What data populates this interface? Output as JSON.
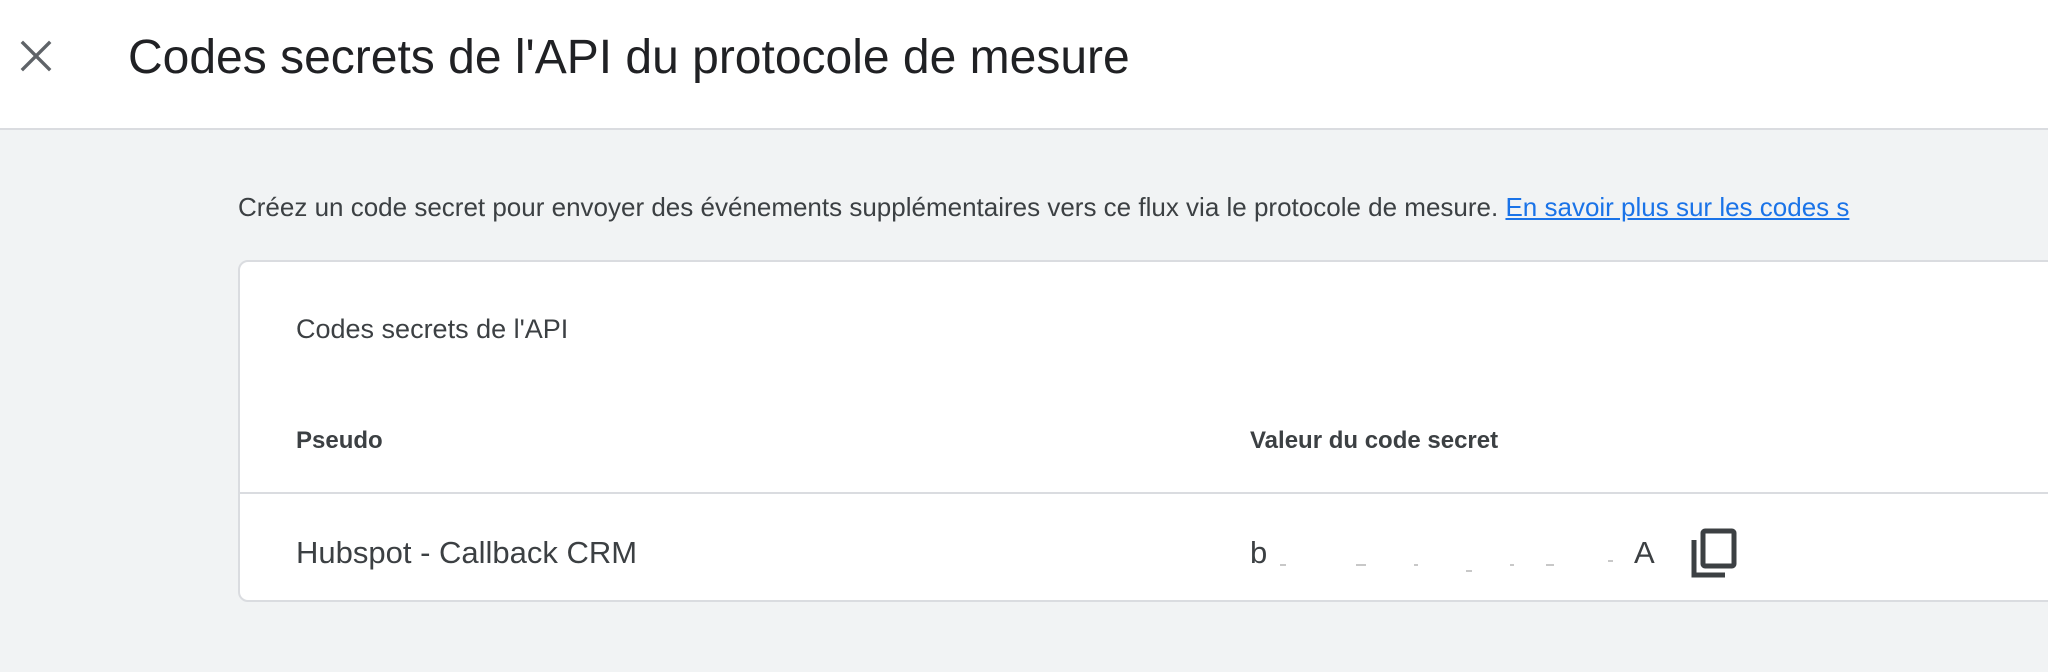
{
  "header": {
    "close_icon": "close-icon",
    "title": "Codes secrets de l'API du protocole de mesure"
  },
  "intro": {
    "text": "Créez un code secret pour envoyer des événements supplémentaires vers ce flux via le protocole de mesure.",
    "link_label": "En savoir plus sur les codes s"
  },
  "card": {
    "title": "Codes secrets de l'API",
    "columns": [
      "Pseudo",
      "Valeur du code secret"
    ],
    "rows": [
      {
        "pseudo": "Hubspot - Callback CRM",
        "secret_start": "b",
        "secret_end": "A",
        "copy_icon": "copy-icon"
      }
    ]
  },
  "colors": {
    "link": "#1a73e8",
    "background": "#f1f3f4",
    "card": "#ffffff",
    "border": "#dadce0",
    "text": "#3c4043"
  }
}
